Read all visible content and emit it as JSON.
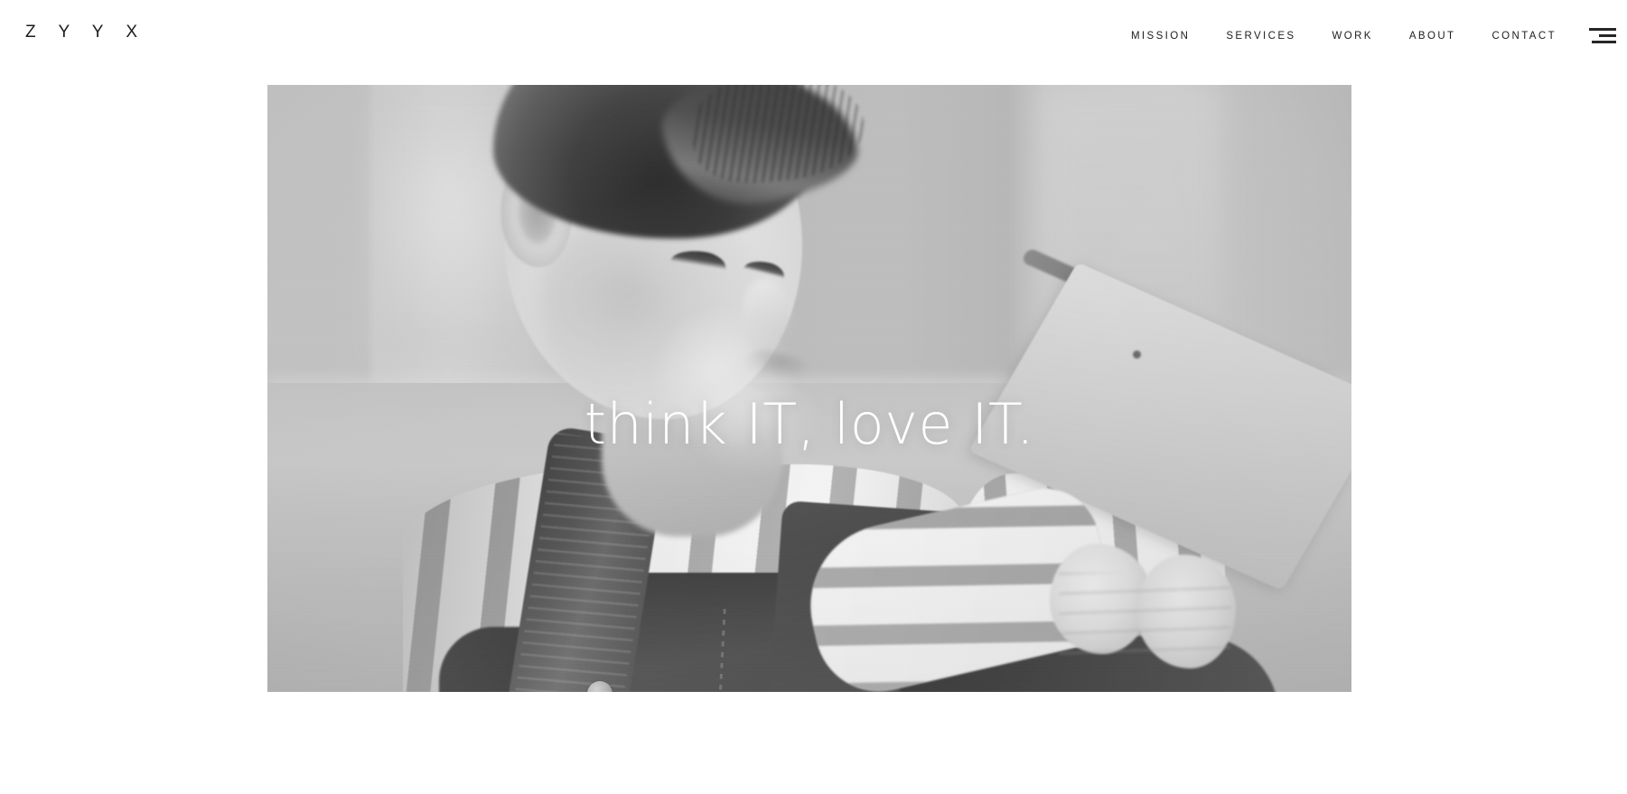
{
  "header": {
    "logo": "Z Y Y X",
    "nav": [
      {
        "label": "MISSION",
        "name": "mission"
      },
      {
        "label": "SERVICES",
        "name": "services"
      },
      {
        "label": "WORK",
        "name": "work"
      },
      {
        "label": "ABOUT",
        "name": "about"
      },
      {
        "label": "CONTACT",
        "name": "contact"
      }
    ],
    "menu_toggle_icon": "hamburger-icon"
  },
  "hero": {
    "headline": "think IT, love IT.",
    "image_alt": "toddler in striped shirt and denim overalls looking at a tablet",
    "image_filter": "grayscale"
  },
  "colors": {
    "page_background": "#ffffff",
    "text": "#1d1d1d",
    "headline": "#ffffff",
    "hero_placeholder": "#b8b8b8"
  }
}
